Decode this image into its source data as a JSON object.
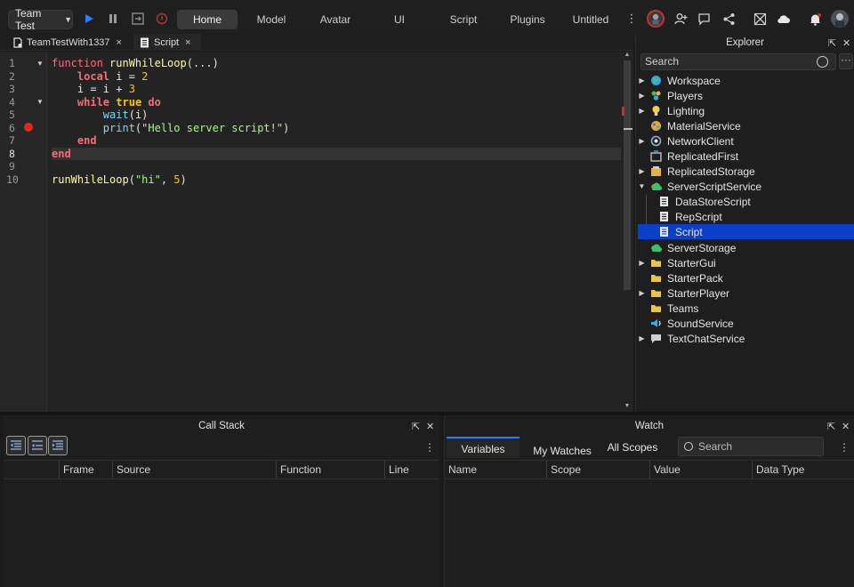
{
  "topbar": {
    "mode": "Team Test",
    "tabs": [
      "Home",
      "Model",
      "Avatar",
      "UI",
      "Script",
      "Plugins",
      "Untitled"
    ],
    "active_tab": "Home"
  },
  "editor": {
    "tabs": [
      {
        "label": "TeamTestWith1337",
        "close": "×"
      },
      {
        "label": "Script",
        "close": "×"
      }
    ],
    "line_numbers": [
      "1",
      "2",
      "3",
      "4",
      "5",
      "6",
      "7",
      "8",
      "9",
      "10"
    ],
    "current_line": 8,
    "breakpoint_line": 6
  },
  "explorer": {
    "title": "Explorer",
    "search_placeholder": "Search",
    "items": [
      {
        "label": "Workspace",
        "color": "#3aa0e8"
      },
      {
        "label": "Players",
        "color": "#58c46a"
      },
      {
        "label": "Lighting",
        "color": "#f2d04a"
      },
      {
        "label": "MaterialService",
        "color": "#e9a33b"
      },
      {
        "label": "NetworkClient",
        "color": "#8fb6d8"
      },
      {
        "label": "ReplicatedFirst",
        "color": "#c7cbd6"
      },
      {
        "label": "ReplicatedStorage",
        "color": "#e0b34c"
      },
      {
        "label": "ServerScriptService",
        "color": "#3fbf6a"
      },
      {
        "label": "DataStoreScript",
        "color": "#e6e6e6"
      },
      {
        "label": "RepScript",
        "color": "#e6e6e6"
      },
      {
        "label": "Script",
        "color": "#e6e6e6"
      },
      {
        "label": "ServerStorage",
        "color": "#3fbf6a"
      },
      {
        "label": "StarterGui",
        "color": "#e8c452"
      },
      {
        "label": "StarterPack",
        "color": "#e8c452"
      },
      {
        "label": "StarterPlayer",
        "color": "#e8c452"
      },
      {
        "label": "Teams",
        "color": "#e8c452"
      },
      {
        "label": "SoundService",
        "color": "#4aa3e0"
      },
      {
        "label": "TextChatService",
        "color": "#d0d0d0"
      }
    ]
  },
  "callstack": {
    "title": "Call Stack",
    "columns": [
      "Frame",
      "Source",
      "Function",
      "Line"
    ]
  },
  "watch": {
    "title": "Watch",
    "tabs": [
      "Variables",
      "My Watches",
      "All Scopes"
    ],
    "search_placeholder": "Search",
    "columns": [
      "Name",
      "Scope",
      "Value",
      "Data Type"
    ]
  },
  "colors": {
    "accent": "#0a3fc9",
    "breakpoint": "#e02626",
    "play": "#2f7bff"
  }
}
